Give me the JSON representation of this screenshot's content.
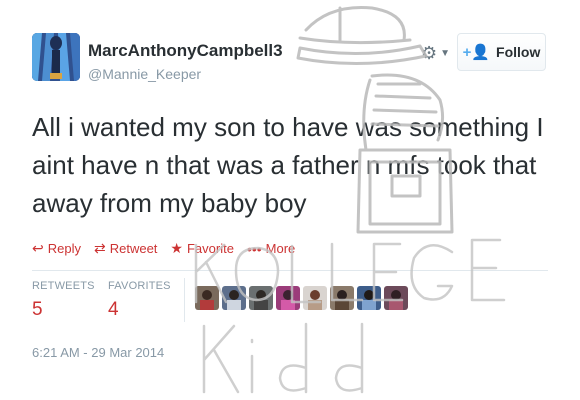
{
  "tweet": {
    "author": {
      "display_name": "MarcAnthonyCampbell3",
      "handle": "@Mannie_Keeper",
      "avatar_icon": "profile-photo"
    },
    "text": "All i wanted my son to have was something I aint have n that was a father n mfs took that away from my baby boy",
    "follow_label": "Follow",
    "settings_icon": "gear-icon",
    "actions": {
      "reply": "Reply",
      "retweet": "Retweet",
      "favorite": "Favorite",
      "more": "More"
    },
    "stats": {
      "retweets_label": "RETWEETS",
      "retweets_count": "5",
      "favorites_label": "FAVORITES",
      "favorites_count": "4"
    },
    "favoriters_icons": [
      "avatar-1",
      "avatar-2",
      "avatar-3",
      "avatar-4",
      "avatar-5",
      "avatar-6",
      "avatar-7",
      "avatar-8"
    ],
    "timestamp": "6:21 AM - 29 Mar 2014"
  },
  "watermark": {
    "line1": "KOLLEGE",
    "line2": "Kidd"
  },
  "colors": {
    "accent": "#55acee",
    "action_red": "#cc3333",
    "muted": "#8899a6",
    "text": "#292f33"
  }
}
